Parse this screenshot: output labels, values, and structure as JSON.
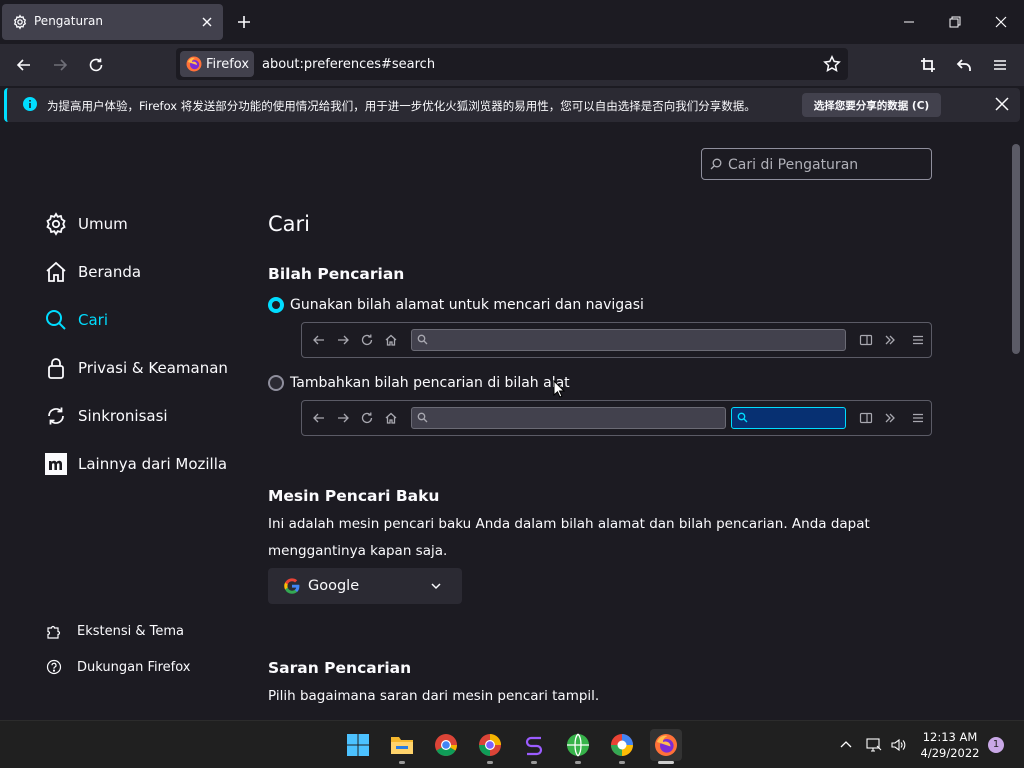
{
  "tab": {
    "title": "Pengaturan"
  },
  "urlbar": {
    "identity_label": "Firefox",
    "url": "about:preferences#search"
  },
  "notification": {
    "message": "为提高用户体验，Firefox 将发送部分功能的使用情况给我们，用于进一步优化火狐浏览器的易用性，您可以自由选择是否向我们分享数据。",
    "button_label": "选择您要分享的数据 (C)"
  },
  "search_prefs": {
    "placeholder": "Cari di Pengaturan"
  },
  "sidebar": {
    "categories": [
      {
        "label": "Umum",
        "icon": "gear-icon"
      },
      {
        "label": "Beranda",
        "icon": "home-icon"
      },
      {
        "label": "Cari",
        "icon": "search-icon",
        "selected": true
      },
      {
        "label": "Privasi & Keamanan",
        "icon": "lock-icon"
      },
      {
        "label": "Sinkronisasi",
        "icon": "sync-icon"
      },
      {
        "label": "Lainnya dari Mozilla",
        "icon": "mozilla-icon"
      }
    ],
    "footer": [
      {
        "label": "Ekstensi & Tema",
        "icon": "puzzle-icon"
      },
      {
        "label": "Dukungan Firefox",
        "icon": "help-icon"
      }
    ]
  },
  "main": {
    "title": "Cari",
    "search_bar_section": {
      "heading": "Bilah Pencarian",
      "option_address_bar": "Gunakan bilah alamat untuk mencari dan navigasi",
      "option_toolbar": "Tambahkan bilah pencarian di bilah alat",
      "selected": "option_address_bar"
    },
    "default_engine_section": {
      "heading": "Mesin Pencari Baku",
      "description_line1": "Ini adalah mesin pencari baku Anda dalam bilah alamat dan bilah pencarian. Anda dapat",
      "description_line2": "menggantinya kapan saja.",
      "selected_engine": "Google"
    },
    "suggestions_section": {
      "heading": "Saran Pencarian",
      "description": "Pilih bagaimana saran dari mesin pencari tampil."
    }
  },
  "taskbar": {
    "time": "12:13 AM",
    "date": "4/29/2022",
    "notification_count": "1"
  },
  "colors": {
    "accent": "#00ddff",
    "background": "#1c1b22",
    "panel": "#2b2a33"
  }
}
